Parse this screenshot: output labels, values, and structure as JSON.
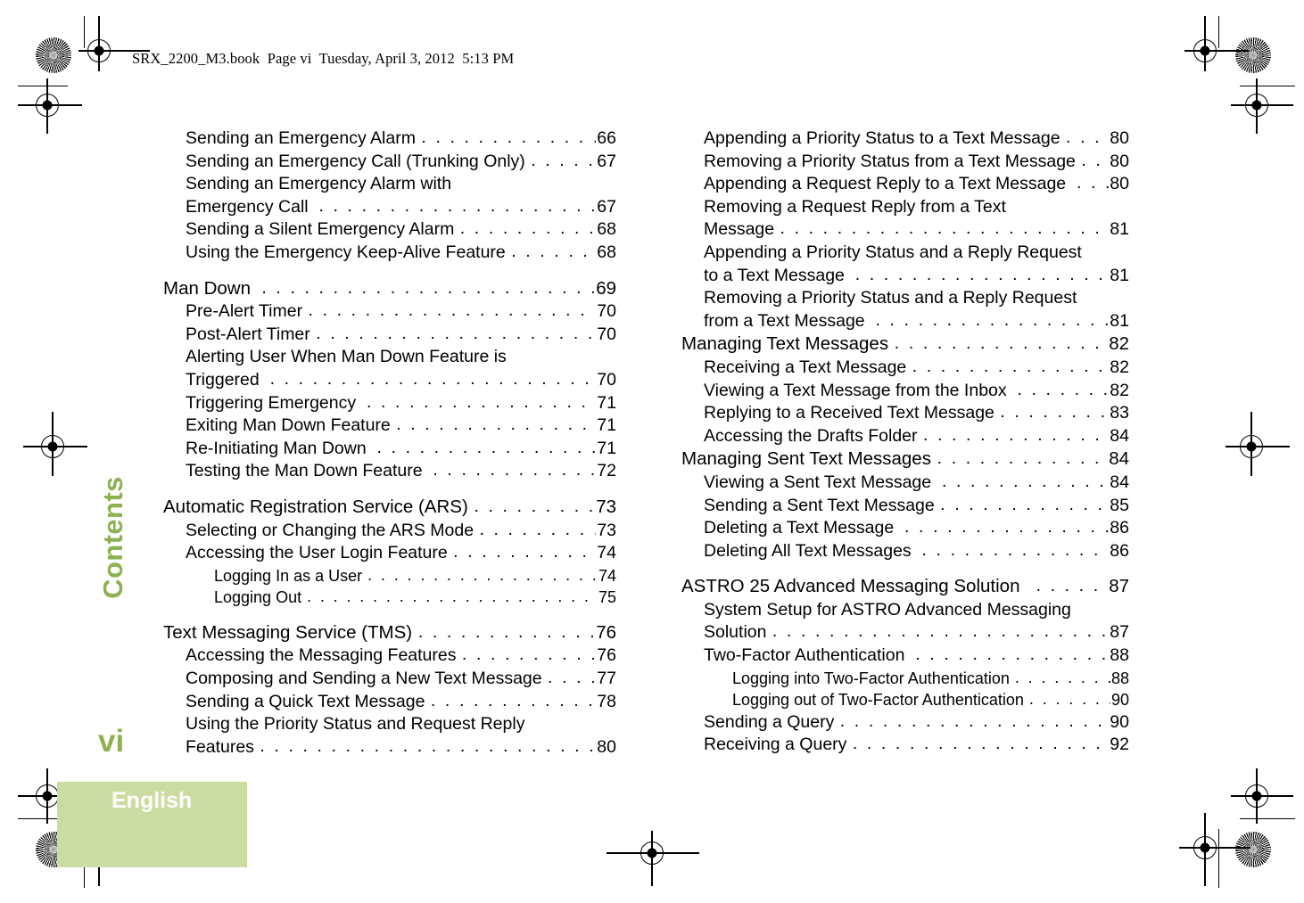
{
  "header": {
    "slug": "SRX_2200_M3.book  Page vi  Tuesday, April 3, 2012  5:13 PM"
  },
  "sidebar": {
    "chapter_label": "Contents",
    "folio": "vi",
    "language_tab": "English",
    "accent_green": "#8db150",
    "tab_green": "#cbdca2"
  },
  "leader": {
    "dots": ". . . . . . . . . . . . . . . . . . . . . . . . . . . . . . . . . . . . . . . . . . . . . . . . . . . . . . . . . . . . . ."
  },
  "toc": {
    "left_column": [
      {
        "level": 2,
        "title": "Sending an Emergency Alarm ",
        "page": "66"
      },
      {
        "level": 2,
        "title": "Sending an Emergency Call (Trunking Only) ",
        "page": "67"
      },
      {
        "level": 2,
        "title": "Sending an Emergency Alarm with",
        "page": "",
        "wrap": true
      },
      {
        "level": 2,
        "title": "Emergency Call  ",
        "page": "67"
      },
      {
        "level": 2,
        "title": "Sending a Silent Emergency Alarm ",
        "page": "68"
      },
      {
        "level": 2,
        "title": "Using the Emergency Keep-Alive Feature ",
        "page": "68"
      },
      {
        "level": 0,
        "title": "",
        "page": "",
        "gap": true
      },
      {
        "level": 1,
        "title": "Man Down  ",
        "page": "69"
      },
      {
        "level": 2,
        "title": "Pre-Alert Timer ",
        "page": "70"
      },
      {
        "level": 2,
        "title": "Post-Alert Timer ",
        "page": "70"
      },
      {
        "level": 2,
        "title": "Alerting User When Man Down Feature is",
        "page": "",
        "wrap": true
      },
      {
        "level": 2,
        "title": "Triggered  ",
        "page": "70"
      },
      {
        "level": 2,
        "title": "Triggering Emergency  ",
        "page": "71"
      },
      {
        "level": 2,
        "title": "Exiting Man Down Feature ",
        "page": "71"
      },
      {
        "level": 2,
        "title": "Re-Initiating Man Down  ",
        "page": "71"
      },
      {
        "level": 2,
        "title": "Testing the Man Down Feature  ",
        "page": "72"
      },
      {
        "level": 0,
        "title": "",
        "page": "",
        "gap": true
      },
      {
        "level": 1,
        "title": "Automatic Registration Service (ARS) ",
        "page": "73"
      },
      {
        "level": 2,
        "title": "Selecting or Changing the ARS Mode ",
        "page": "73"
      },
      {
        "level": 2,
        "title": "Accessing the User Login Feature ",
        "page": "74"
      },
      {
        "level": 3,
        "title": "Logging In as a User ",
        "page": "74"
      },
      {
        "level": 3,
        "title": "Logging Out ",
        "page": "75"
      },
      {
        "level": 0,
        "title": "",
        "page": "",
        "gap": true
      },
      {
        "level": 1,
        "title": "Text Messaging Service (TMS) ",
        "page": "76"
      },
      {
        "level": 2,
        "title": "Accessing the Messaging Features ",
        "page": "76"
      },
      {
        "level": 2,
        "title": "Composing and Sending a New Text Message ",
        "page": "77"
      },
      {
        "level": 2,
        "title": "Sending a Quick Text Message ",
        "page": "78"
      },
      {
        "level": 2,
        "title": "Using the Priority Status and Request Reply",
        "page": "",
        "wrap": true
      },
      {
        "level": 2,
        "title": "Features ",
        "page": "80"
      }
    ],
    "right_column": [
      {
        "level": 2,
        "title": "Appending a Priority Status to a Text Message ",
        "page": "80"
      },
      {
        "level": 2,
        "title": "Removing a Priority Status from a Text Message ",
        "page": "80"
      },
      {
        "level": 2,
        "title": "Appending a Request Reply to a Text Message  ",
        "page": "80"
      },
      {
        "level": 2,
        "title": "Removing a Request Reply from a Text",
        "page": "",
        "wrap": true
      },
      {
        "level": 2,
        "title": "Message ",
        "page": "81"
      },
      {
        "level": 2,
        "title": "Appending a Priority Status and a Reply Request",
        "page": "",
        "wrap": true
      },
      {
        "level": 2,
        "title": "to a Text Message  ",
        "page": "81"
      },
      {
        "level": 2,
        "title": "Removing a Priority Status and a Reply Request",
        "page": "",
        "wrap": true
      },
      {
        "level": 2,
        "title": "from a Text Message  ",
        "page": "81"
      },
      {
        "level": 1,
        "title": "Managing Text Messages ",
        "page": "82"
      },
      {
        "level": 2,
        "title": "Receiving a Text Message ",
        "page": "82"
      },
      {
        "level": 2,
        "title": "Viewing a Text Message from the Inbox  ",
        "page": "82"
      },
      {
        "level": 2,
        "title": "Replying to a Received Text Message ",
        "page": "83"
      },
      {
        "level": 2,
        "title": "Accessing the Drafts Folder ",
        "page": "84"
      },
      {
        "level": 1,
        "title": "Managing Sent Text Messages ",
        "page": "84"
      },
      {
        "level": 2,
        "title": "Viewing a Sent Text Message  ",
        "page": "84"
      },
      {
        "level": 2,
        "title": "Sending a Sent Text Message ",
        "page": "85"
      },
      {
        "level": 2,
        "title": "Deleting a Text Message  ",
        "page": "86"
      },
      {
        "level": 2,
        "title": "Deleting All Text Messages  ",
        "page": "86"
      },
      {
        "level": 0,
        "title": "",
        "page": "",
        "gap": true
      },
      {
        "level": 1,
        "title": "ASTRO 25 Advanced Messaging Solution   ",
        "page": "87"
      },
      {
        "level": 2,
        "title": "System Setup for ASTRO Advanced Messaging",
        "page": "",
        "wrap": true
      },
      {
        "level": 2,
        "title": "Solution ",
        "page": "87"
      },
      {
        "level": 2,
        "title": "Two-Factor Authentication  ",
        "page": "88"
      },
      {
        "level": 3,
        "title": "Logging into Two-Factor Authentication ",
        "page": "88"
      },
      {
        "level": 3,
        "title": "Logging out of Two-Factor Authentication ",
        "page": "90"
      },
      {
        "level": 2,
        "title": "Sending a Query ",
        "page": "90"
      },
      {
        "level": 2,
        "title": "Receiving a Query ",
        "page": "92"
      }
    ]
  }
}
